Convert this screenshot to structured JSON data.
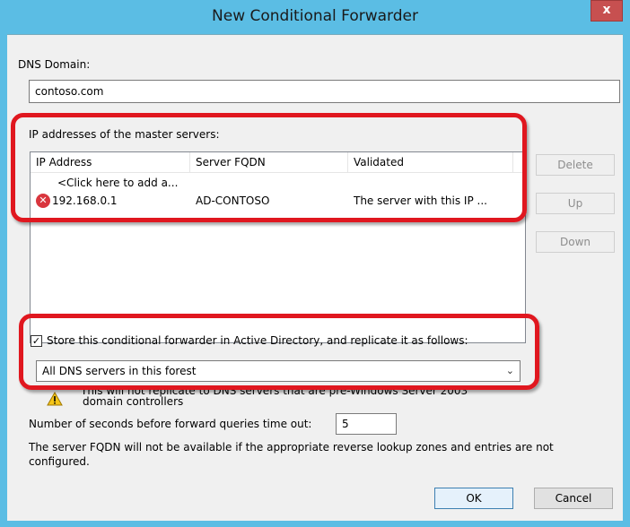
{
  "window": {
    "title": "New Conditional Forwarder",
    "close_glyph": "x"
  },
  "dns_domain": {
    "label": "DNS Domain:",
    "value": "contoso.com"
  },
  "master_servers": {
    "label": "IP addresses of the master servers:",
    "columns": [
      "IP Address",
      "Server FQDN",
      "Validated"
    ],
    "add_row": "<Click here to add a...",
    "rows": [
      {
        "icon": "error-icon",
        "ip": "192.168.0.1",
        "fqdn": "AD-CONTOSO",
        "validated": "The server with this IP ..."
      }
    ]
  },
  "side_buttons": {
    "delete": "Delete",
    "up": "Up",
    "down": "Down"
  },
  "store_ad": {
    "checked": true,
    "label": "Store this conditional forwarder in Active Directory, and replicate it as follows:",
    "selected_option": "All DNS servers in this forest"
  },
  "warning": {
    "line1": "This will not replicate to DNS servers that are pre-Windows Server 2003",
    "line2": "domain controllers"
  },
  "timeout": {
    "label": "Number of seconds before forward queries time out:",
    "value": "5"
  },
  "note": {
    "line1": "The server FQDN will not be available if the appropriate reverse lookup zones and entries are not",
    "line2": "configured."
  },
  "footer": {
    "ok": "OK",
    "cancel": "Cancel"
  },
  "colors": {
    "titlebar": "#5bbde4",
    "highlight": "#e0171f",
    "client": "#f0f0f0"
  }
}
